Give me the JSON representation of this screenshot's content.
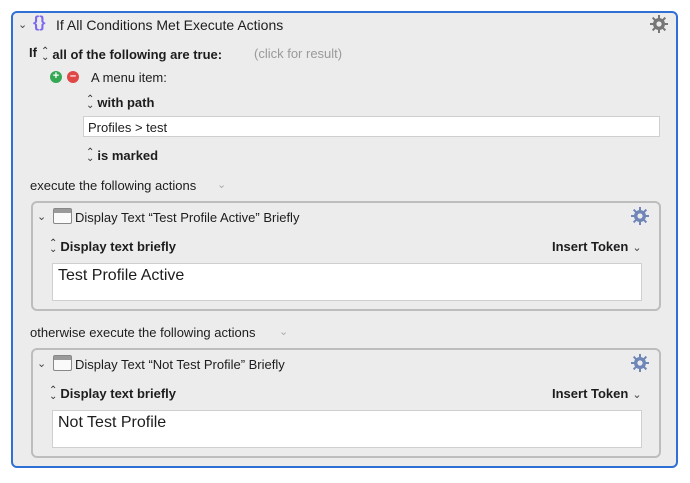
{
  "header": {
    "title": "If All Conditions Met Execute Actions",
    "icon_label": "{}"
  },
  "condition": {
    "if_label": "If",
    "match_selector": "all of the following are true:",
    "result_hint": "(click for result)",
    "item_label": "A menu item:",
    "path_selector": "with path",
    "path_value": "Profiles > test",
    "state_selector": "is marked"
  },
  "execute_label": "execute the following actions",
  "otherwise_label": "otherwise execute the following actions",
  "actions": [
    {
      "title": "Display Text “Test Profile Active” Briefly",
      "mode_label": "Display text briefly",
      "token_label": "Insert Token",
      "text": "Test Profile Active"
    },
    {
      "title": "Display Text “Not Test Profile” Briefly",
      "mode_label": "Display text briefly",
      "token_label": "Insert Token",
      "text": "Not Test Profile"
    }
  ],
  "colors": {
    "selection_border": "#2f6fd6",
    "panel_bg": "#ececec",
    "add": "#34a853",
    "remove": "#e04848",
    "icon_purple": "#7b68ee"
  }
}
